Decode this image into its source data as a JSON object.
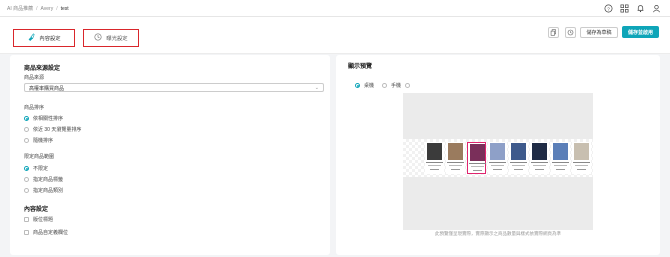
{
  "breadcrumb": {
    "root": "AI 商品推薦",
    "sep": "/",
    "user": "Avery",
    "page": "test"
  },
  "icons": {
    "help": "help-circle-icon",
    "apps": "grid-icon",
    "bell": "bell-icon",
    "user": "user-icon"
  },
  "tabs": [
    {
      "label": "內容設定",
      "icon": "brush-icon"
    },
    {
      "label": "曝光設定",
      "icon": "clock-icon"
    }
  ],
  "toolbar": {
    "draft_label": "儲存為草稿",
    "save_label": "儲存並啟用"
  },
  "left": {
    "source_section": "商品來源設定",
    "source_label": "商品來源",
    "source_value": "高權率購買商品",
    "sort_label": "商品排序",
    "sort_options": [
      "依相關性排序",
      "依近 30 天瀏覽量排序",
      "隨機排序"
    ],
    "range_label": "限定商品範圍",
    "range_options": [
      "不限定",
      "指定商品標籤",
      "指定商品類別"
    ],
    "content_section": "內容設定",
    "content_options": [
      "版位標題",
      "商品自定義欄位"
    ]
  },
  "right": {
    "title": "顯示預覽",
    "device_options": [
      "桌機",
      "手機"
    ],
    "hint": "此預覽僅呈現實際，實際顯示之商品數量與樣式依實際網頁為準",
    "products": [
      {
        "name": "pants",
        "color": "#3b3b3b"
      },
      {
        "name": "coat",
        "color": "#9a7b5e"
      },
      {
        "name": "dress",
        "color": "#7a2f5a"
      },
      {
        "name": "top",
        "color": "#8ea0c8"
      },
      {
        "name": "shirt",
        "color": "#3e5a8c"
      },
      {
        "name": "vest",
        "color": "#1f2b45"
      },
      {
        "name": "cap",
        "color": "#5b7fb8"
      },
      {
        "name": "hat",
        "color": "#c8bfb0"
      }
    ]
  },
  "colors": {
    "accent": "#0ea5b8",
    "highlight": "#d9262b"
  }
}
